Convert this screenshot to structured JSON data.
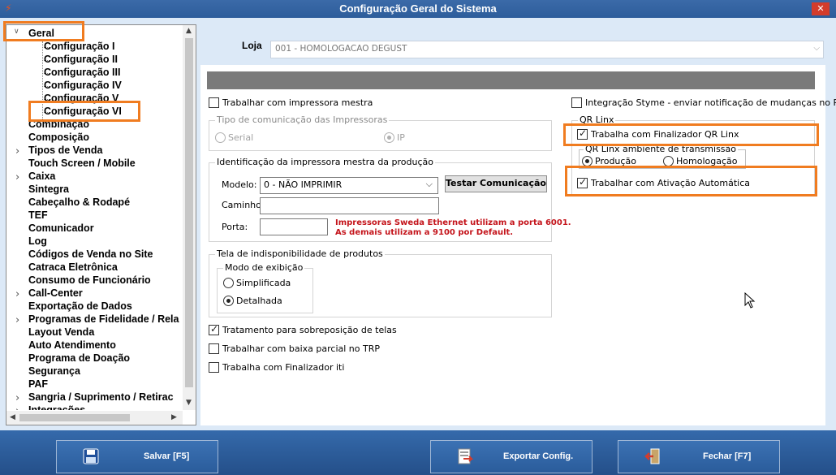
{
  "window": {
    "title": "Configuração Geral do Sistema",
    "close_glyph": "✕",
    "app_icon": "lightning-icon"
  },
  "tree": {
    "nodes": [
      {
        "label": "Geral",
        "expanded": true
      },
      {
        "label": "Configuração I"
      },
      {
        "label": "Configuração II"
      },
      {
        "label": "Configuração III"
      },
      {
        "label": "Configuração IV"
      },
      {
        "label": "Configuração V"
      },
      {
        "label": "Configuração VI",
        "selected": true
      },
      {
        "label": "Combinação"
      },
      {
        "label": "Composição"
      },
      {
        "label": "Tipos de Venda",
        "expandable": true
      },
      {
        "label": "Touch Screen / Mobile"
      },
      {
        "label": "Caixa",
        "expandable": true
      },
      {
        "label": "Sintegra"
      },
      {
        "label": "Cabeçalho & Rodapé"
      },
      {
        "label": "TEF"
      },
      {
        "label": "Comunicador"
      },
      {
        "label": "Log"
      },
      {
        "label": "Códigos de Venda no Site"
      },
      {
        "label": "Catraca Eletrônica"
      },
      {
        "label": "Consumo de Funcionário"
      },
      {
        "label": "Call-Center",
        "expandable": true
      },
      {
        "label": "Exportação de Dados"
      },
      {
        "label": "Programas de Fidelidade / Rela",
        "expandable": true
      },
      {
        "label": "Layout Venda"
      },
      {
        "label": "Auto Atendimento"
      },
      {
        "label": "Programa de Doação"
      },
      {
        "label": "Segurança"
      },
      {
        "label": "PAF"
      },
      {
        "label": "Sangria / Suprimento / Retirac",
        "expandable": true
      },
      {
        "label": "Integrações",
        "expandable": true
      }
    ]
  },
  "loja": {
    "label": "Loja",
    "value": "001 - HOMOLOGACAO DEGUST"
  },
  "left": {
    "impressora_mestra": {
      "label": "Trabalhar com impressora mestra",
      "checked": false
    },
    "tipo_comunicacao": {
      "legend": "Tipo de comunicação das Impressoras",
      "serial": "Serial",
      "ip": "IP",
      "selected": "IP"
    },
    "identificacao": {
      "legend": "Identificação da impressora mestra da produção",
      "modelo_label": "Modelo:",
      "modelo_value": "0 - NÃO IMPRIMIR",
      "testar_button": "Testar Comunicação",
      "caminho_label": "Caminho:",
      "caminho_value": "",
      "porta_label": "Porta:",
      "porta_value": "",
      "warning_line1": "Impressoras Sweda Ethernet utilizam a porta 6001.",
      "warning_line2": "As demais utilizam a 9100 por Default."
    },
    "indisponibilidade": {
      "legend": "Tela de indisponibilidade de produtos",
      "modo_legend": "Modo de exibição",
      "simplificada": "Simplificada",
      "detalhada": "Detalhada",
      "selected": "Detalhada"
    },
    "sobreposicao": {
      "label": "Tratamento para sobreposição de telas",
      "checked": true
    },
    "baixa_parcial": {
      "label": "Trabalhar com baixa parcial no TRP",
      "checked": false
    },
    "finalizador_iti": {
      "label": "Trabalha com Finalizador iti",
      "checked": false
    }
  },
  "right": {
    "styme": {
      "label": "Integração Styme - enviar notificação de mudanças no PDV",
      "checked": false
    },
    "qr_linx": {
      "legend": "QR Linx",
      "finalizador": {
        "label": "Trabalha com Finalizador QR Linx",
        "checked": true
      },
      "ambiente_legend": "QR Linx ambiente de transmissão",
      "producao": "Produção",
      "homologacao": "Homologação",
      "selected": "Produção",
      "ativacao": {
        "label": "Trabalhar com Ativação Automática",
        "checked": true
      }
    }
  },
  "footer": {
    "save": "Salvar [F5]",
    "export": "Exportar Config.",
    "close": "Fechar [F7]"
  },
  "colors": {
    "highlight": "#f07c20",
    "warning": "#c4141b",
    "titlebar": "#2d5d9b"
  }
}
